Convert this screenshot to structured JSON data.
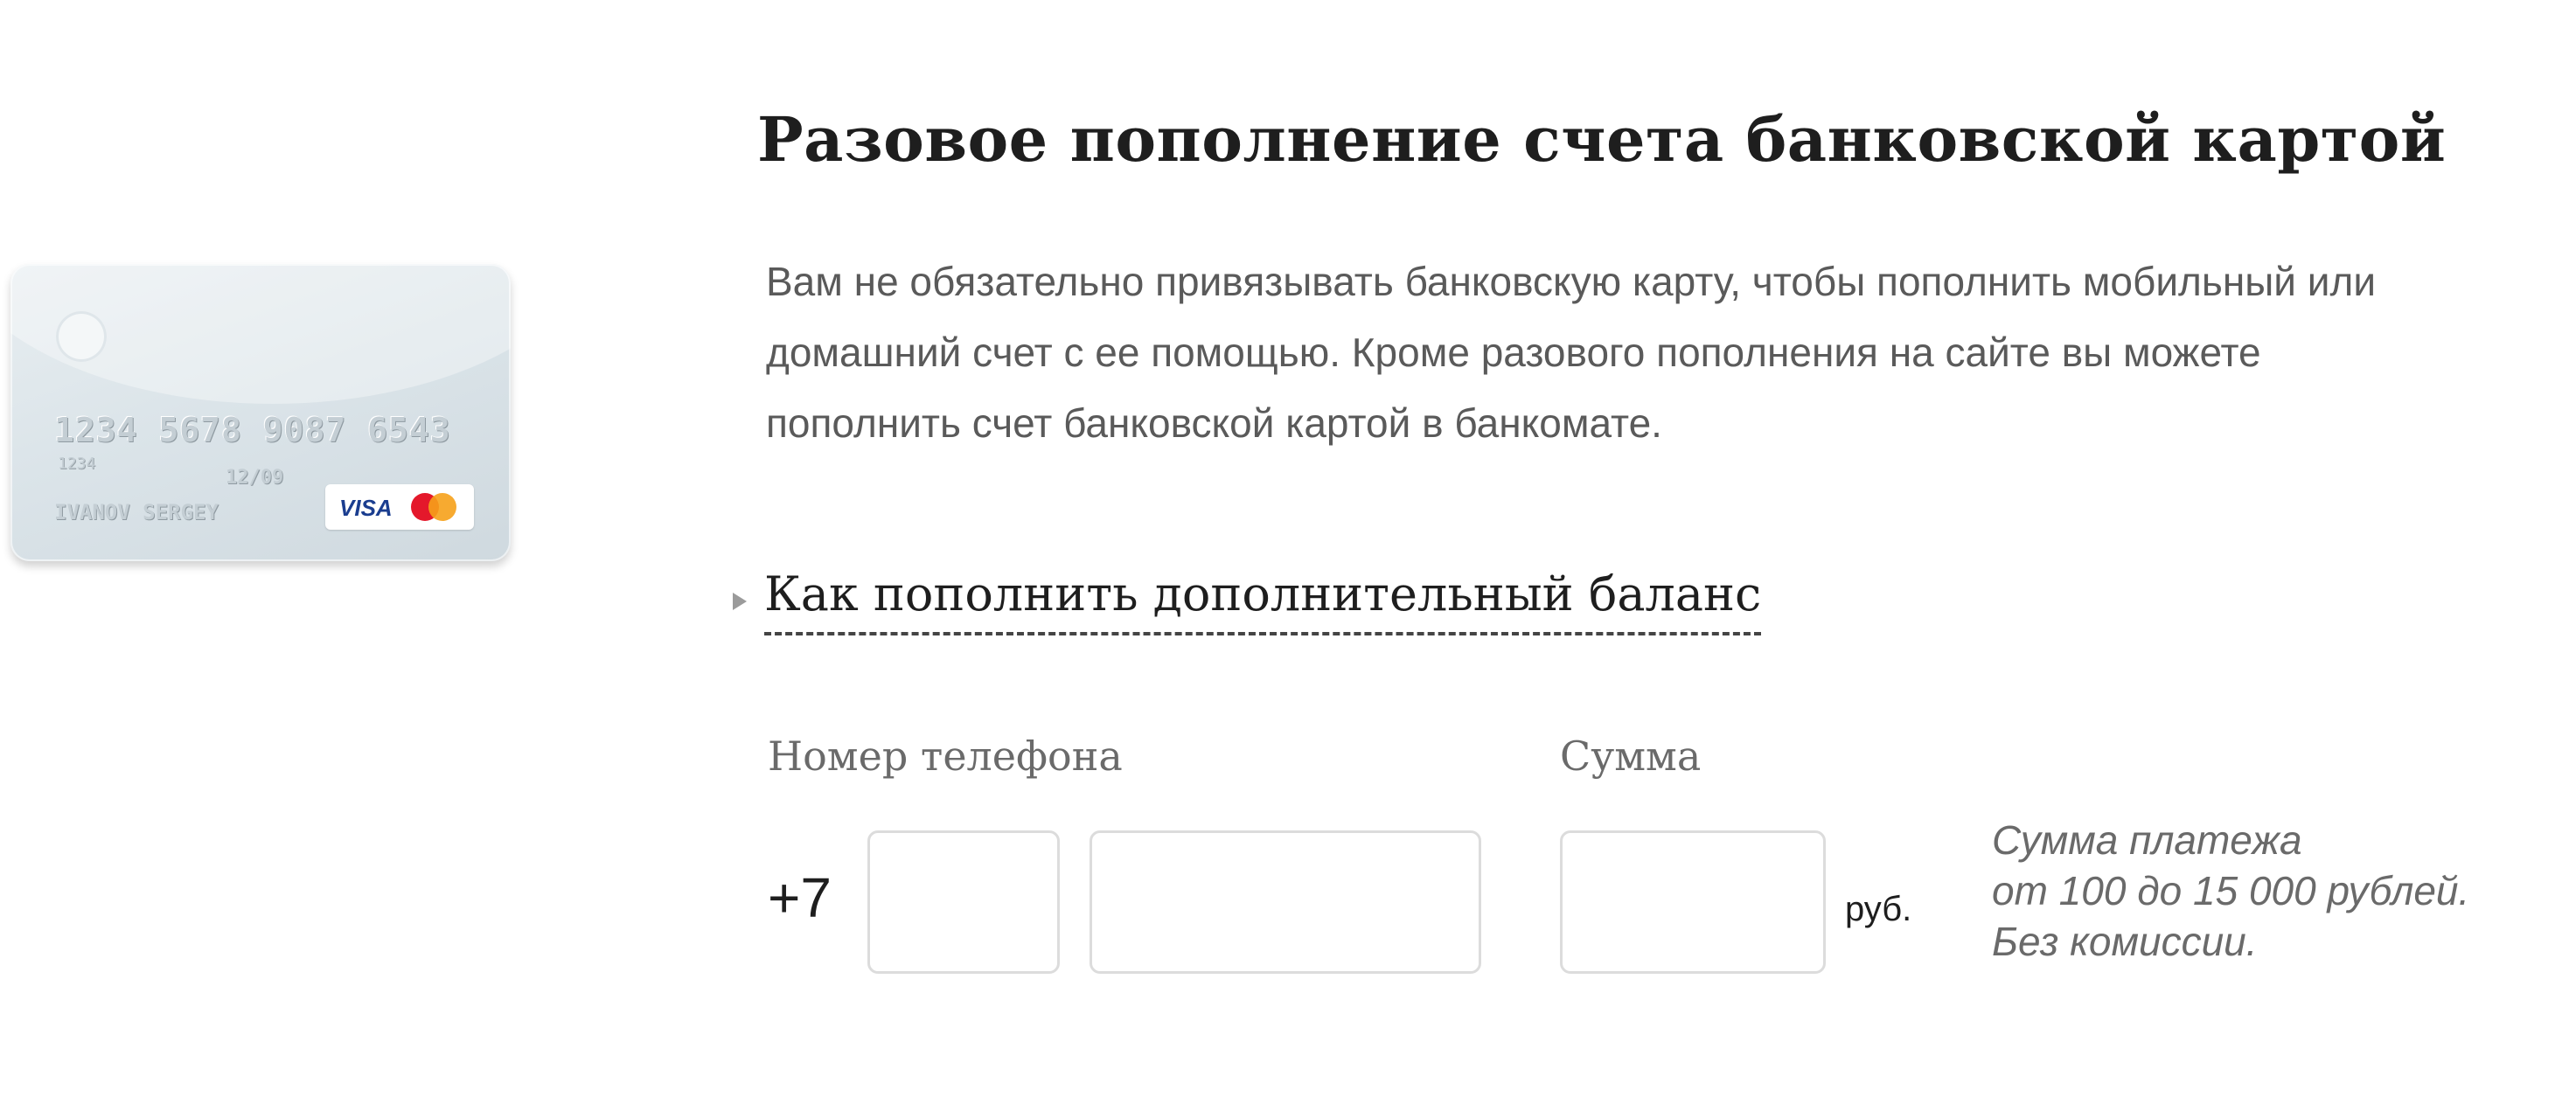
{
  "card": {
    "number": "1234 5678 9087 6543",
    "small_number": "1234",
    "expiry": "12/09",
    "holder": "IVANOV SERGEY",
    "brand_visa": "VISA",
    "brand_mastercard": "MasterCard",
    "icons": [
      "card-chip-icon",
      "visa-logo",
      "mastercard-logo"
    ]
  },
  "header": {
    "title": "Разовое пополнение счета банковской картой"
  },
  "description": "Вам не обязательно привязывать банковскую карту, чтобы пополнить мобильный или домашний счет с ее помощью. Кроме разового пополнения на сайте вы можете пополнить счет банковской картой в банкомате.",
  "expander": {
    "label": "Как пополнить дополнительный баланс",
    "icon": "triangle-right-icon"
  },
  "form": {
    "phone_label": "Номер телефона",
    "country_code": "+7",
    "code_value": "",
    "phone_value": "",
    "sum_label": "Сумма",
    "sum_value": "",
    "currency": "руб.",
    "note_lines": [
      "Сумма платежа",
      "от 100 до 15 000 рублей.",
      "Без комиссии."
    ]
  },
  "colors": {
    "title": "#1e1e1e",
    "text_gray": "#5a5a5a",
    "input_border": "#dcdcdc",
    "background": "#ffffff"
  }
}
